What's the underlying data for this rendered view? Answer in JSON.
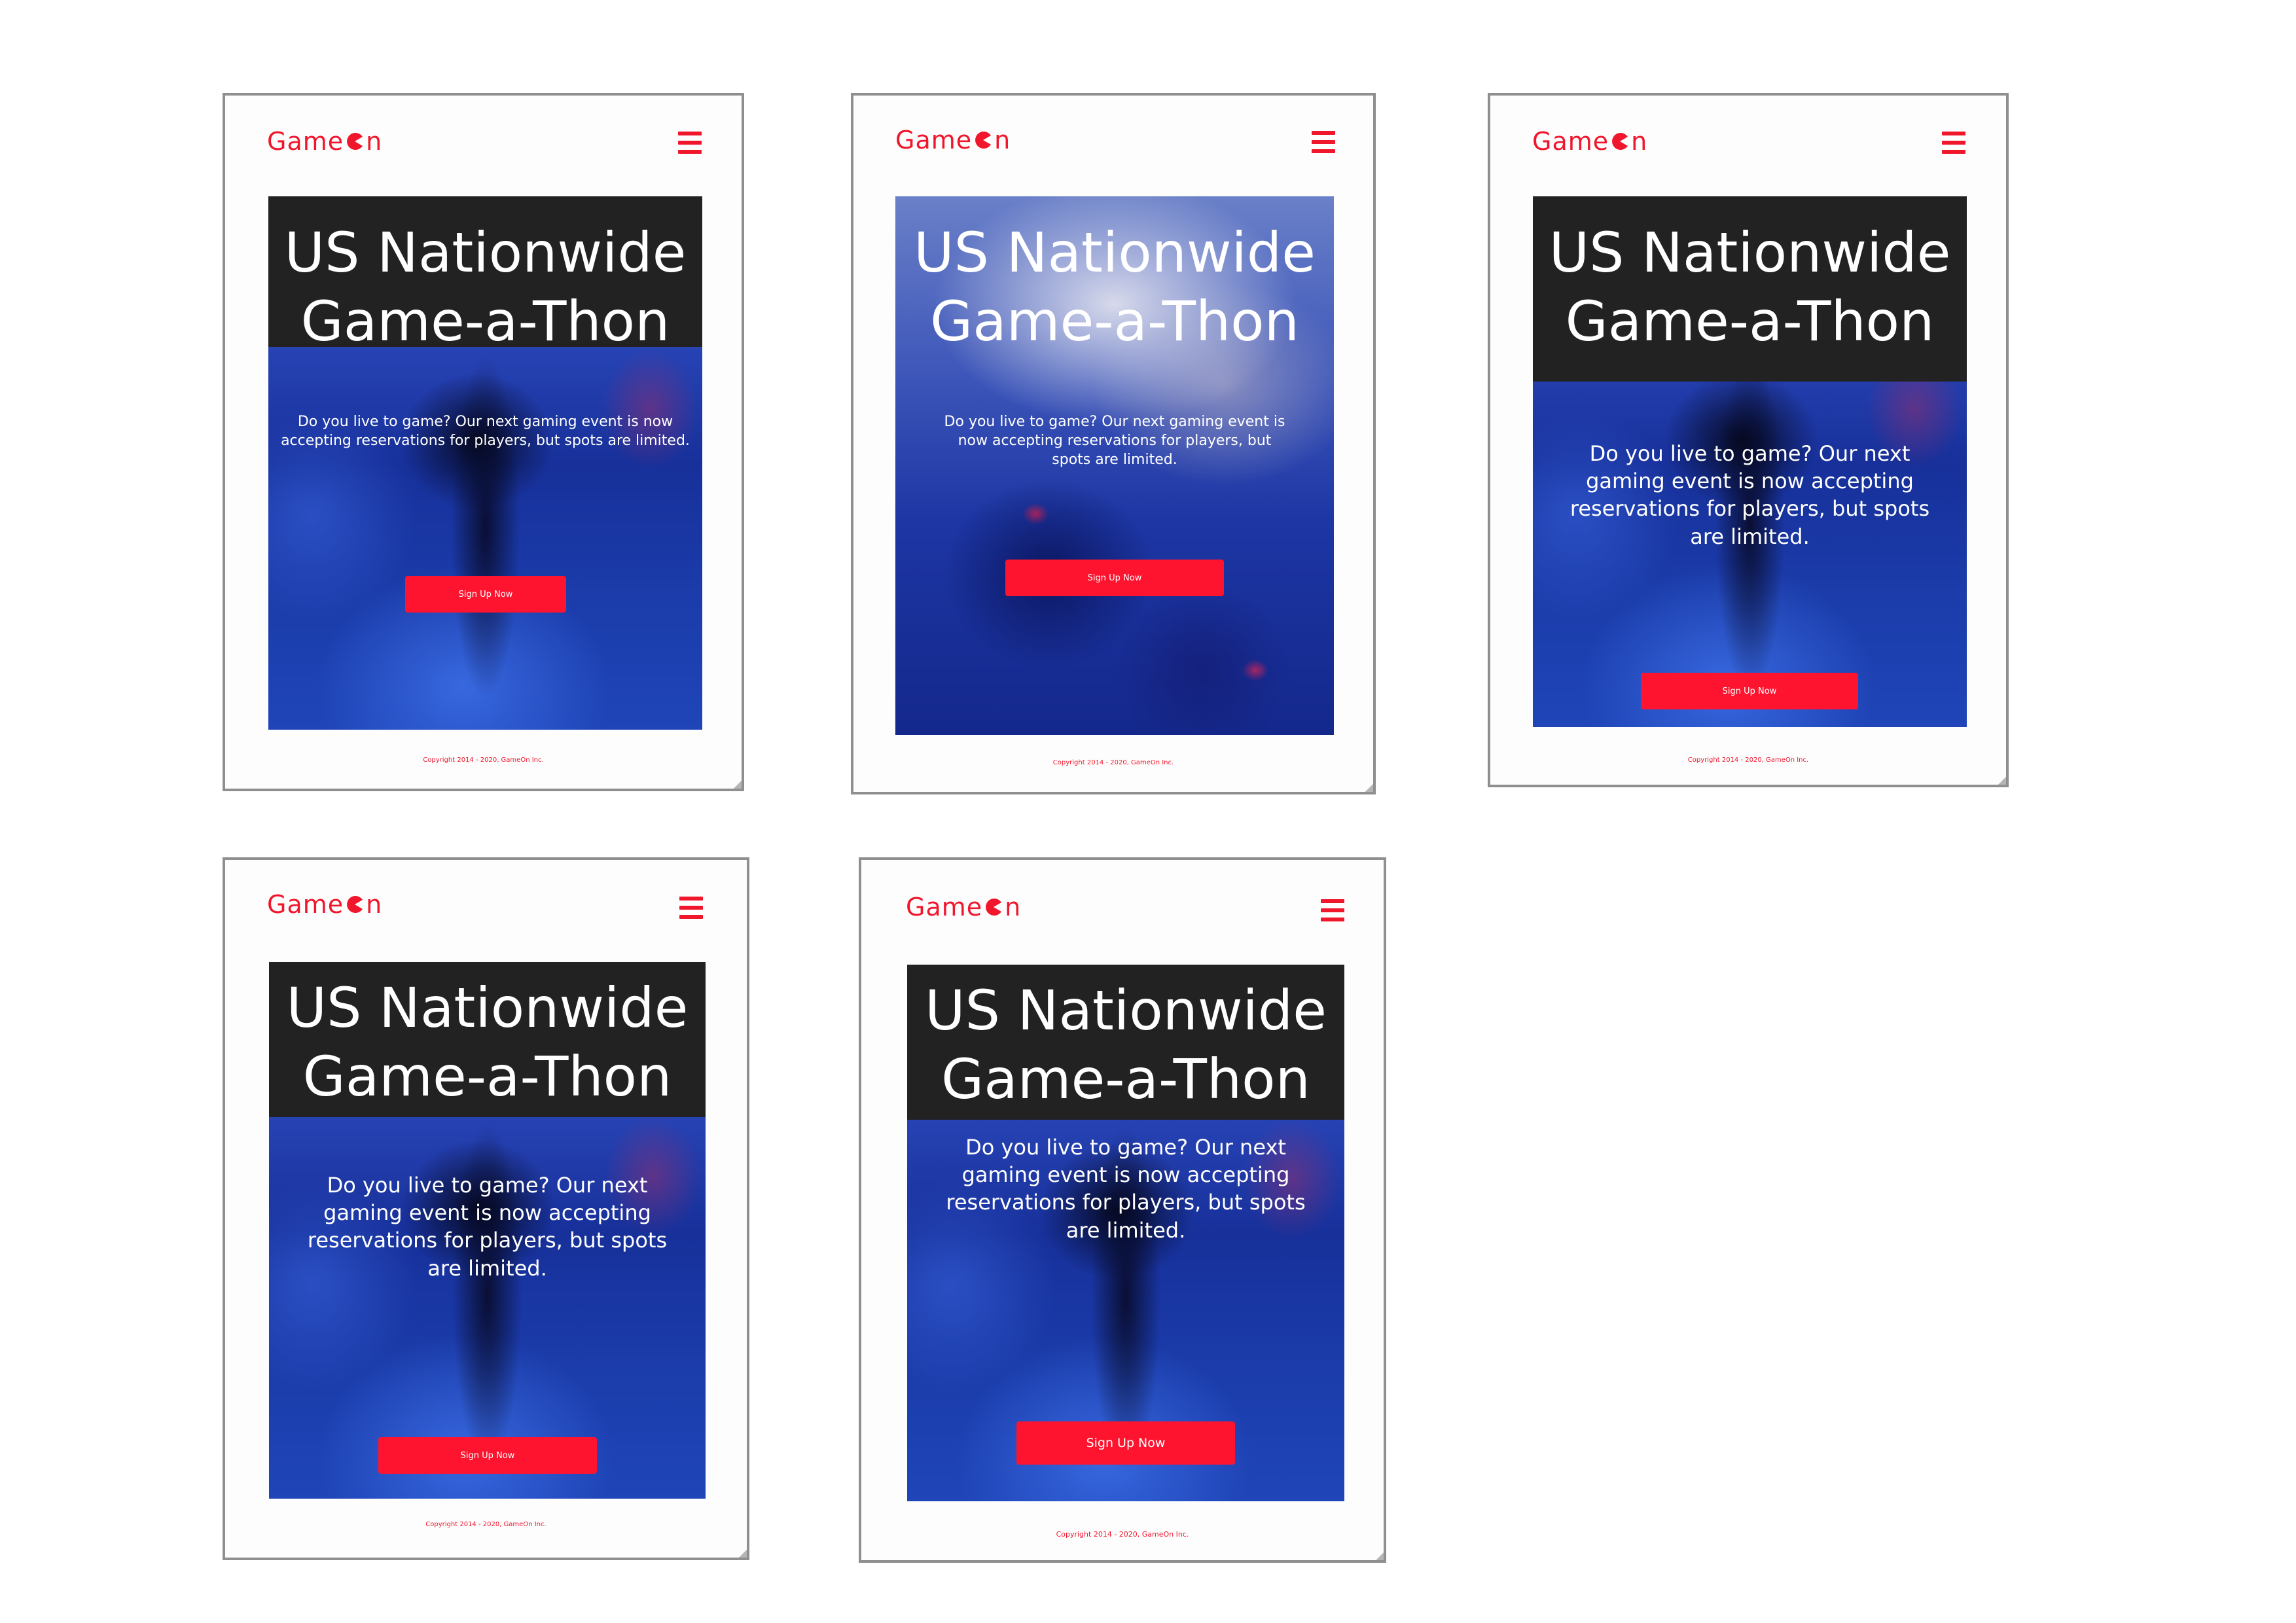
{
  "app": {
    "brand_prefix": "Game",
    "brand_suffix": "n",
    "accent_color": "#f0162c",
    "button_color": "#fe142f",
    "title_bg_color": "#222222"
  },
  "hero": {
    "title_line1": "US Nationwide",
    "title_line2": "Game-a-Thon",
    "description": "Do you live to game? Our next gaming event is now accepting reservations for players, but spots are limited.",
    "cta_label": "Sign Up Now"
  },
  "footer": {
    "copyright": "Copyright 2014 - 2020, GameOn Inc."
  },
  "icons": {
    "menu": "hamburger-menu-icon",
    "logo_o": "pacman-o-icon"
  }
}
